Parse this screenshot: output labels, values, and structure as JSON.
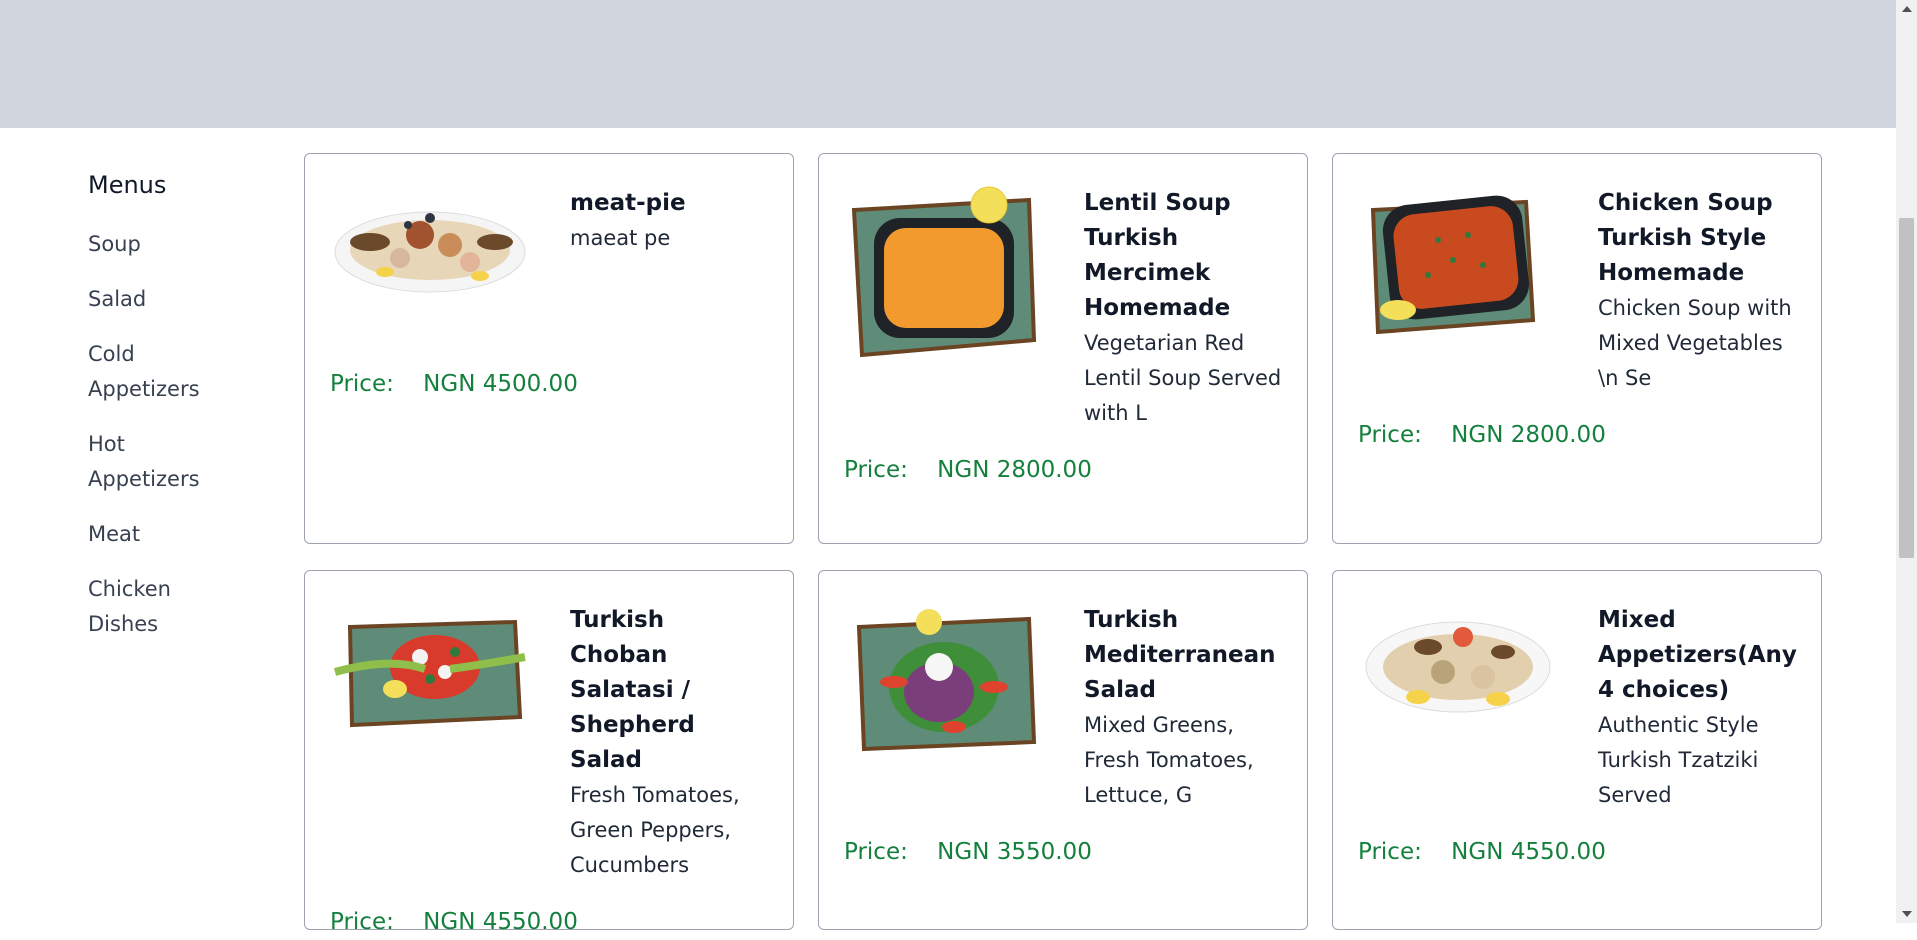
{
  "sidebar": {
    "heading": "Menus",
    "items": [
      "Soup",
      "Salad",
      "Cold Appetizers",
      "Hot Appetizers",
      "Meat",
      "Chicken Dishes"
    ]
  },
  "price_label": "Price:",
  "products": [
    {
      "title": "meat-pie",
      "desc": "maeat pe",
      "price": "NGN 4500.00",
      "image": "platter-image"
    },
    {
      "title": "Lentil Soup Turkish Mercimek Homemade",
      "desc": "Vegetarian Red Lentil Soup Served with L",
      "price": "NGN 2800.00",
      "image": "lentil-soup-image"
    },
    {
      "title": "Chicken Soup Turkish Style Homemade",
      "desc": "Chicken Soup with Mixed Vegetables \\n Se",
      "price": "NGN 2800.00",
      "image": "chicken-soup-image"
    },
    {
      "title": "Turkish Choban Salatasi / Shepherd Salad",
      "desc": "Fresh Tomatoes, Green Peppers, Cucumbers",
      "price": "NGN 4550.00",
      "image": "shepherd-salad-image"
    },
    {
      "title": "Turkish Mediterranean Salad",
      "desc": "Mixed Greens, Fresh Tomatoes, Lettuce, G",
      "price": "NGN 3550.00",
      "image": "mediterranean-salad-image"
    },
    {
      "title": "Mixed Appetizers(Any 4 choices)",
      "desc": "Authentic Style Turkish Tzatziki Served",
      "price": "NGN 4550.00",
      "image": "mixed-appetizers-image"
    }
  ],
  "colors": {
    "topbar": "#d1d5de",
    "price": "#15803d",
    "border": "#9ca3af"
  }
}
